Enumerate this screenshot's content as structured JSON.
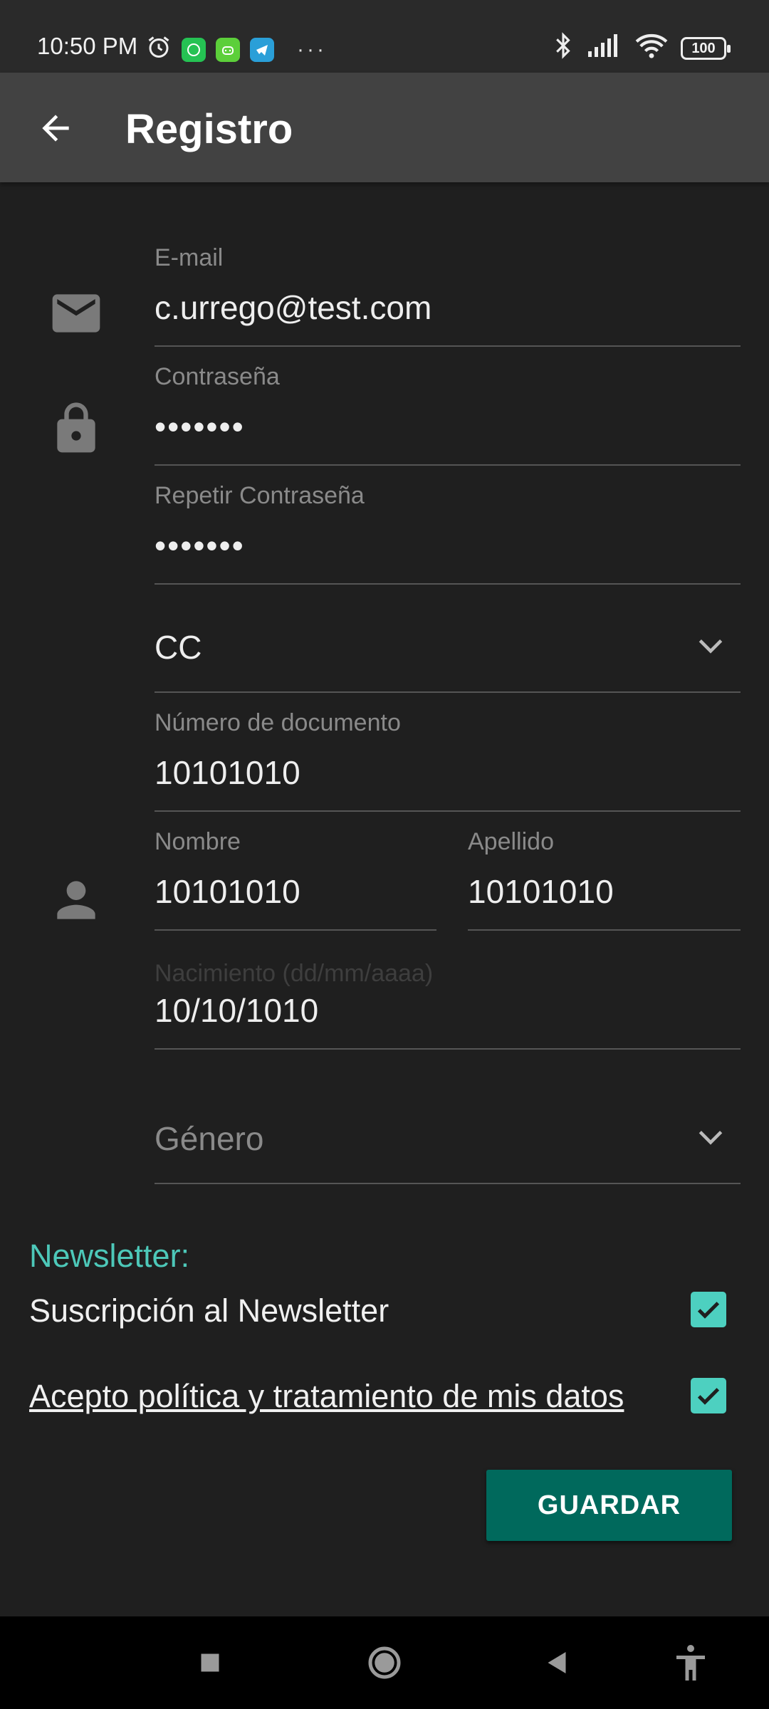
{
  "status_bar": {
    "time": "10:50 PM",
    "battery": "100",
    "icons": [
      "alarm-icon",
      "whatsapp-icon",
      "android-icon",
      "telegram-icon",
      "more-dots-icon",
      "bluetooth-icon",
      "signal-icon",
      "wifi-icon",
      "battery-icon"
    ]
  },
  "appbar": {
    "title": "Registro"
  },
  "form": {
    "email": {
      "label": "E-mail",
      "value": "c.urrego@test.com"
    },
    "password": {
      "label": "Contraseña",
      "value": "•••••••"
    },
    "repeat_password": {
      "label": "Repetir Contraseña",
      "value": "•••••••"
    },
    "doc_type": {
      "value": "CC"
    },
    "doc_number": {
      "label": "Número de documento",
      "value": "10101010"
    },
    "first_name": {
      "label": "Nombre",
      "value": "10101010"
    },
    "last_name": {
      "label": "Apellido",
      "value": "10101010"
    },
    "birth": {
      "label": "Nacimiento (dd/mm/aaaa)",
      "value": "10/10/1010"
    },
    "gender": {
      "placeholder": "Género"
    }
  },
  "newsletter": {
    "heading": "Newsletter:",
    "subscription_label": "Suscripción al Newsletter",
    "policy_label": "Acepto política y tratamiento de mis datos"
  },
  "save_button": "GUARDAR",
  "colors": {
    "accent": "#4dd0c0",
    "button": "#00695c",
    "appbar": "#424242",
    "background": "#1f1f1f"
  }
}
